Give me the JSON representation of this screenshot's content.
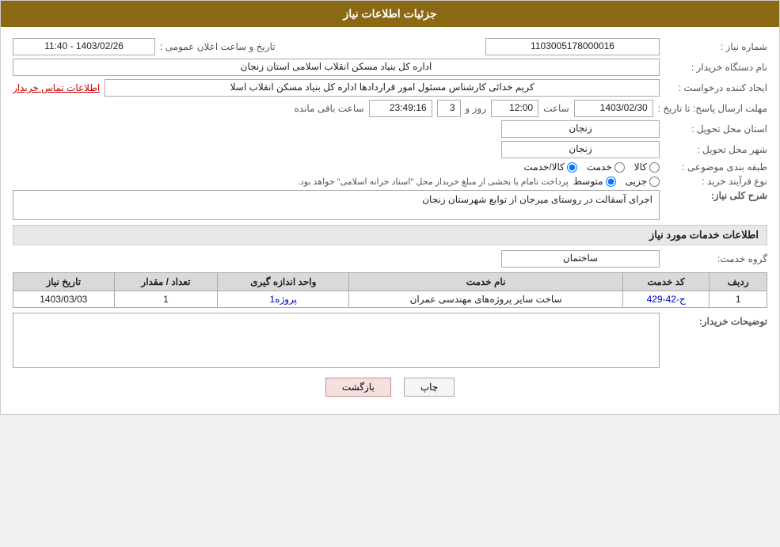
{
  "header": {
    "title": "جزئیات اطلاعات نیاز"
  },
  "fields": {
    "shomareNiaz_label": "شماره نیاز :",
    "shomareNiaz_value": "1103005178000016",
    "namDasgah_label": "نام دستگاه خریدار :",
    "namDasgah_value": "اداره کل بنیاد مسکن انقلاب اسلامی استان زنجان",
    "tarikh_label": "تاریخ و ساعت اعلان عمومی :",
    "tarikh_value": "1403/02/26 - 11:40",
    "ijadKonande_label": "ایجاد کننده درخواست :",
    "ijadKonande_value": "کریم خدائی کارشناس مسئول امور قراردادها اداره کل بنیاد مسکن انقلاب اسلا",
    "contact_text": "اطلاعات تماس خریدار",
    "mohlatErsal_label": "مهلت ارسال پاسخ: تا تاریخ :",
    "mohlatErsal_date": "1403/02/30",
    "mohlatErsal_saat_label": "ساعت",
    "mohlatErsal_saat": "12:00",
    "mohlatErsal_roz_label": "روز و",
    "mohlatErsal_roz": "3",
    "mohlatErsal_mande": "23:49:16",
    "mohlatErsal_mande_label": "ساعت باقی مانده",
    "ostan_label": "استان محل تحویل :",
    "ostan_value": "زنجان",
    "shahr_label": "شهر محل تحویل :",
    "shahr_value": "زنجان",
    "tabaghebandi_label": "طبقه بندی موضوعی :",
    "radio_kala": "کالا",
    "radio_khedmat": "خدمت",
    "radio_kala_khedmat": "کالا/خدمت",
    "selected_tabaghebandi": "kala_khedmat",
    "novFarayand_label": "نوع فرآیند خرید :",
    "radio_jozi": "جزیی",
    "radio_mottavasset": "متوسط",
    "novFarayand_desc": "پرداخت تامام یا بخشی از مبلغ خریداز محل \"اسناد خزانه اسلامی\" خواهد بود.",
    "selected_novFarayand": "mottavasset",
    "sharhKoli_label": "شرح کلی نیاز:",
    "sharhKoli_value": "اجرای آسفالت در روستای   میرجان  از توابع شهرستان زنجان",
    "khadamat_title": "اطلاعات خدمات مورد نیاز",
    "groupKhedmat_label": "گروه خدمت:",
    "groupKhedmat_value": "ساختمان",
    "table": {
      "headers": [
        "ردیف",
        "کد خدمت",
        "نام خدمت",
        "واحد اندازه گیری",
        "تعداد / مقدار",
        "تاریخ نیاز"
      ],
      "rows": [
        {
          "radif": "1",
          "kod": "ج-42-429",
          "name": "ساخت سایر پروژه‌های مهندسی عمران",
          "unit": "پروژه1",
          "tedad": "1",
          "tarikh": "1403/03/03"
        }
      ]
    },
    "tozihat_label": "توضیحات خریدار:",
    "tozihat_value": "",
    "btn_print": "چاپ",
    "btn_back": "بازگشت"
  }
}
